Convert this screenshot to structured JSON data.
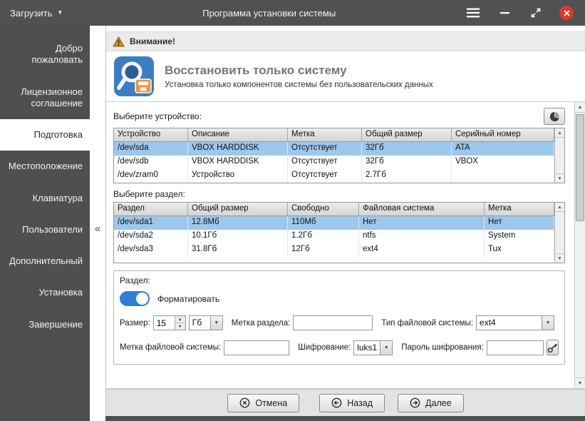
{
  "colors": {
    "titlebar_bg": "#515151",
    "sidebar_bg": "#4f4f4f",
    "selection_blue": "#9ec7ec",
    "toggle_blue": "#2e7fd3",
    "close_red": "#d83a30",
    "warning_yellow": "#c79100"
  },
  "icons": {
    "caret_down": "▼",
    "caret_up": "▲",
    "collapse_left": "«"
  },
  "titlebar": {
    "load_button": "Загрузить",
    "title": "Программа установки системы"
  },
  "sidebar": {
    "items": [
      {
        "label": "Добро пожаловать"
      },
      {
        "label": "Лицензионное соглашение"
      },
      {
        "label": "Подготовка",
        "active": true
      },
      {
        "label": "Местоположение"
      },
      {
        "label": "Клавиатура"
      },
      {
        "label": "Пользователи"
      },
      {
        "label": "Дополнительный"
      },
      {
        "label": "Установка"
      },
      {
        "label": "Завершение"
      }
    ]
  },
  "warning": {
    "label": "Внимание!"
  },
  "header": {
    "title": "Восстановить только систему",
    "subtitle": "Установка только компонентов системы без пользовательских данных"
  },
  "device_section": {
    "label": "Выберите устройство:",
    "columns": [
      "Устройство",
      "Описание",
      "Метка",
      "Общий размер",
      "Серийный номер"
    ],
    "rows": [
      [
        "/dev/sda",
        "VBOX HARDDISK",
        "Отсутствует",
        "32Гб",
        "ATA"
      ],
      [
        "/dev/sdb",
        "VBOX HARDDISK",
        "Отсутствует",
        "32Гб",
        "VBOX"
      ],
      [
        "/dev/zram0",
        "Устройство",
        "Отсутствует",
        "2.7Гб",
        ""
      ]
    ],
    "selected_row": 0
  },
  "partition_section": {
    "label": "Выберите раздел:",
    "columns": [
      "Раздел",
      "Общий размер",
      "Свободно",
      "Файловая система",
      "Метка"
    ],
    "rows": [
      [
        "/dev/sda1",
        "12.8Мб",
        "110Мб",
        "Нет",
        "Нет"
      ],
      [
        "/dev/sda2",
        "10.1Гб",
        "1.2Гб",
        "ntfs",
        "System"
      ],
      [
        "/dev/sda3",
        "31.8Гб",
        "12Гб",
        "ext4",
        "Tux"
      ]
    ],
    "selected_row": 0
  },
  "partition_form": {
    "group_label": "Раздел:",
    "format_label": "Форматировать",
    "format_on": true,
    "size_label": "Размер:",
    "size_value": "15",
    "size_unit": "Гб",
    "partition_label_label": "Метка раздела:",
    "partition_label_value": "",
    "fs_type_label": "Тип файловой системы:",
    "fs_type_value": "ext4",
    "fs_label_label": "Метка файловой системы:",
    "fs_label_value": "",
    "encryption_label": "Шифрование:",
    "encryption_value": "luks1",
    "password_label": "Пароль шифрования:",
    "password_value": ""
  },
  "footer": {
    "cancel": "Отмена",
    "back": "Назад",
    "next": "Далее"
  }
}
